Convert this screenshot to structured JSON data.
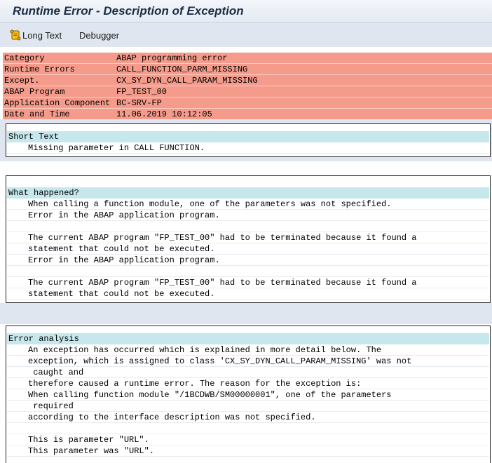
{
  "window": {
    "title": "Runtime Error - Description of Exception"
  },
  "toolbar": {
    "long_text_label": "Long Text",
    "debugger_label": "Debugger"
  },
  "summary": [
    {
      "label": "Category",
      "value": "ABAP programming error"
    },
    {
      "label": "Runtime Errors",
      "value": "CALL_FUNCTION_PARM_MISSING"
    },
    {
      "label": "Except.",
      "value": "CX_SY_DYN_CALL_PARAM_MISSING"
    },
    {
      "label": "ABAP Program",
      "value": "FP_TEST_00"
    },
    {
      "label": "Application Component",
      "value": "BC-SRV-FP"
    },
    {
      "label": "Date and Time",
      "value": "11.06.2019 10:12:05"
    }
  ],
  "short_text": {
    "title": "Short Text",
    "lines": [
      "Missing parameter in CALL FUNCTION."
    ]
  },
  "what_happened": {
    "title": "What happened?",
    "lines": [
      "When calling a function module, one of the parameters was not specified.",
      "Error in the ABAP application program.",
      "",
      "The current ABAP program \"FP_TEST_00\" had to be terminated because it found a",
      "statement that could not be executed.",
      "Error in the ABAP application program.",
      "",
      "The current ABAP program \"FP_TEST_00\" had to be terminated because it found a",
      "statement that could not be executed."
    ]
  },
  "error_analysis": {
    "title": "Error analysis",
    "lines": [
      "An exception has occurred which is explained in more detail below. The",
      "exception, which is assigned to class 'CX_SY_DYN_CALL_PARAM_MISSING' was not",
      " caught and",
      "therefore caused a runtime error. The reason for the exception is:",
      "When calling function module \"/1BCDWB/SM00000001\", one of the parameters",
      " required",
      "according to the interface description was not specified.",
      "",
      "This is parameter \"URL\".",
      "This parameter was \"URL\"."
    ]
  },
  "colors": {
    "summary_bg": "#f49b8b",
    "panel_title_bg": "#c6e8ec",
    "frame_bg": "#dfe6ef"
  }
}
